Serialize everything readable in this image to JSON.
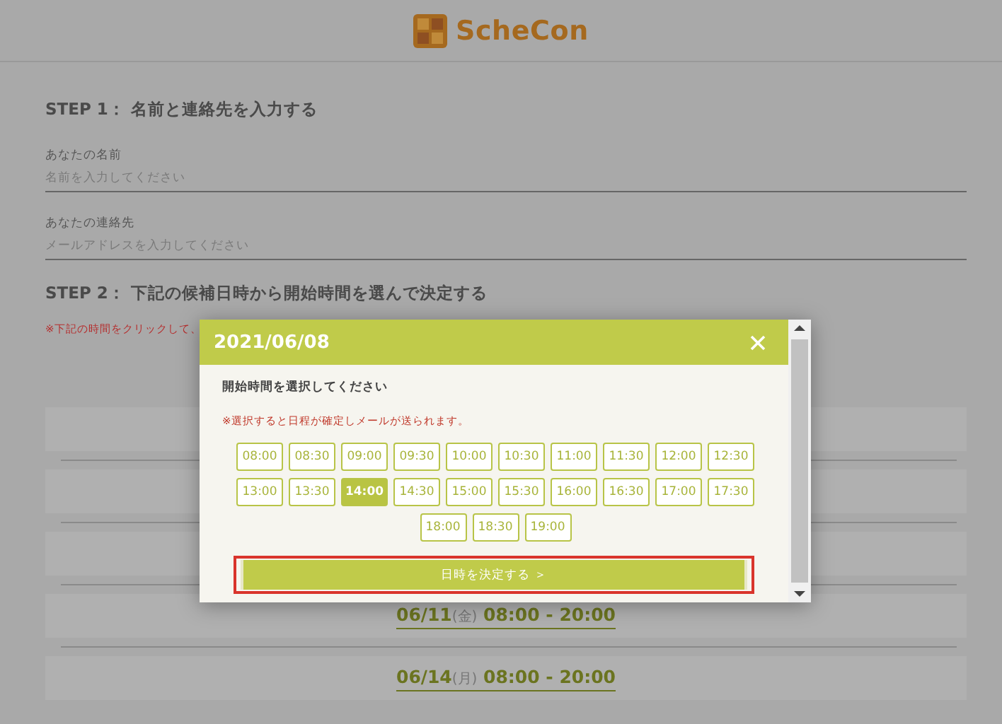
{
  "header": {
    "logo_text": "ScheCon"
  },
  "step1": {
    "title": "STEP 1： 名前と連絡先を入力する",
    "fields": [
      {
        "label": "あなたの名前",
        "placeholder": "名前を入力してください"
      },
      {
        "label": "あなたの連絡先",
        "placeholder": "メールアドレスを入力してください"
      }
    ]
  },
  "step2": {
    "title": "STEP 2： 下記の候補日時から開始時間を選んで決定する",
    "note": "※下記の時間をクリックして、",
    "dates": [
      {
        "date": "06/11",
        "weekday": "(金)",
        "time": "08:00 - 20:00"
      },
      {
        "date": "06/14",
        "weekday": "(月)",
        "time": "08:00 - 20:00"
      }
    ]
  },
  "modal": {
    "title": "2021/06/08",
    "prompt": "開始時間を選択してください",
    "notice": "※選択すると日程が確定しメールが送られます。",
    "times": [
      {
        "label": "08:00",
        "selected": false
      },
      {
        "label": "08:30",
        "selected": false
      },
      {
        "label": "09:00",
        "selected": false
      },
      {
        "label": "09:30",
        "selected": false
      },
      {
        "label": "10:00",
        "selected": false
      },
      {
        "label": "10:30",
        "selected": false
      },
      {
        "label": "11:00",
        "selected": false
      },
      {
        "label": "11:30",
        "selected": false
      },
      {
        "label": "12:00",
        "selected": false
      },
      {
        "label": "12:30",
        "selected": false
      },
      {
        "label": "13:00",
        "selected": false
      },
      {
        "label": "13:30",
        "selected": false
      },
      {
        "label": "14:00",
        "selected": true
      },
      {
        "label": "14:30",
        "selected": false
      },
      {
        "label": "15:00",
        "selected": false
      },
      {
        "label": "15:30",
        "selected": false
      },
      {
        "label": "16:00",
        "selected": false
      },
      {
        "label": "16:30",
        "selected": false
      },
      {
        "label": "17:00",
        "selected": false
      },
      {
        "label": "17:30",
        "selected": false
      },
      {
        "label": "18:00",
        "selected": false
      },
      {
        "label": "18:30",
        "selected": false
      },
      {
        "label": "19:00",
        "selected": false
      }
    ],
    "confirm": {
      "label": "日時を決定する ＞",
      "highlighted": true
    }
  }
}
